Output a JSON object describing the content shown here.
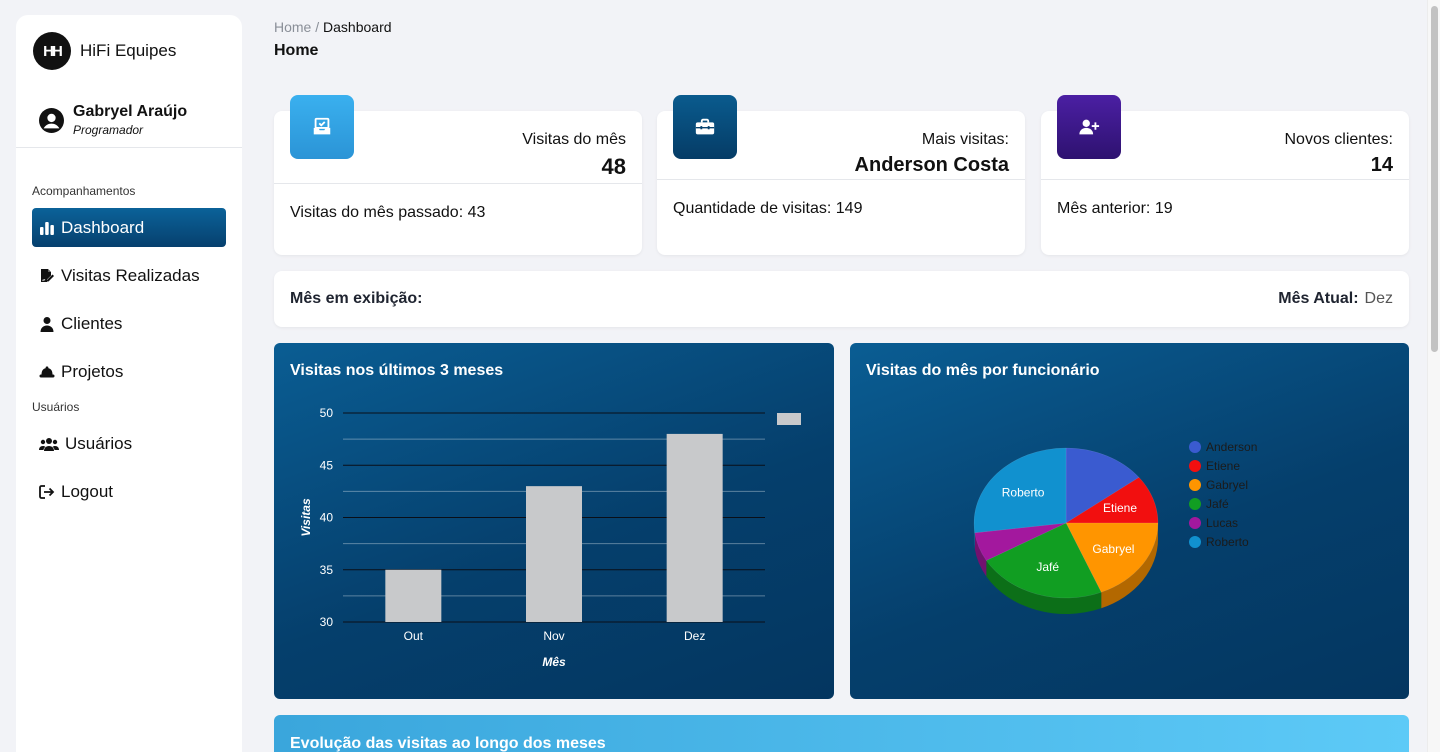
{
  "brand": {
    "logo": "HH",
    "name": "HiFi Equipes"
  },
  "user": {
    "name": "Gabryel Araújo",
    "role": "Programador"
  },
  "sidebar": {
    "section1": "Acompanhamentos",
    "section2": "Usuários",
    "items": [
      {
        "label": "Dashboard",
        "icon": "bar-chart-icon",
        "active": true
      },
      {
        "label": "Visitas Realizadas",
        "icon": "file-signature-icon"
      },
      {
        "label": "Clientes",
        "icon": "person-icon"
      },
      {
        "label": "Projetos",
        "icon": "hard-hat-icon"
      },
      {
        "label": "Usuários",
        "icon": "users-icon"
      },
      {
        "label": "Logout",
        "icon": "logout-icon"
      }
    ]
  },
  "breadcrumb": {
    "home": "Home",
    "sep": "/",
    "current": "Dashboard"
  },
  "page_title": "Home",
  "cards": [
    {
      "label": "Visitas do mês",
      "value": "48",
      "foot": "Visitas do mês passado: 43",
      "icon": "inbox-check-icon",
      "color": "#35a4e3"
    },
    {
      "label": "Mais visitas:",
      "value": "Anderson Costa",
      "foot": "Quantidade de visitas: 149",
      "icon": "toolbox-icon",
      "color": "#06426f"
    },
    {
      "label": "Novos clientes:",
      "value": "14",
      "foot": "Mês anterior: 19",
      "icon": "user-plus-icon",
      "color": "#3d1a8c"
    }
  ],
  "month": {
    "label": "Mês em exibição:",
    "current_label": "Mês Atual:",
    "current_value": "Dez"
  },
  "charts": {
    "bar_title": "Visitas nos últimos 3 meses",
    "pie_title": "Visitas do mês por funcionário",
    "evo_title": "Evolução das visitas ao longo dos meses"
  },
  "chart_data": [
    {
      "type": "bar",
      "title": "Visitas nos últimos 3 meses",
      "categories": [
        "Out",
        "Nov",
        "Dez"
      ],
      "values": [
        35,
        43,
        48
      ],
      "xlabel": "Mês",
      "ylabel": "Visitas",
      "ylim": [
        30,
        50
      ],
      "yticks": [
        30,
        35,
        40,
        45,
        50
      ],
      "grid": true,
      "bar_color": "#c8c9cb"
    },
    {
      "type": "pie",
      "title": "Visitas do mês por funcionário",
      "labels": [
        "Anderson",
        "Etiene",
        "Gabryel",
        "Jafé",
        "Lucas",
        "Roberto"
      ],
      "values": [
        7,
        5,
        9,
        11,
        3,
        13
      ],
      "colors": [
        "#3a5bd0",
        "#f20f0f",
        "#ff9500",
        "#119e22",
        "#a3189e",
        "#1191cf"
      ],
      "slice_labels_shown": [
        "Roberto",
        "Etiene",
        "Gabryel",
        "Jafé"
      ],
      "legend": "right"
    }
  ]
}
